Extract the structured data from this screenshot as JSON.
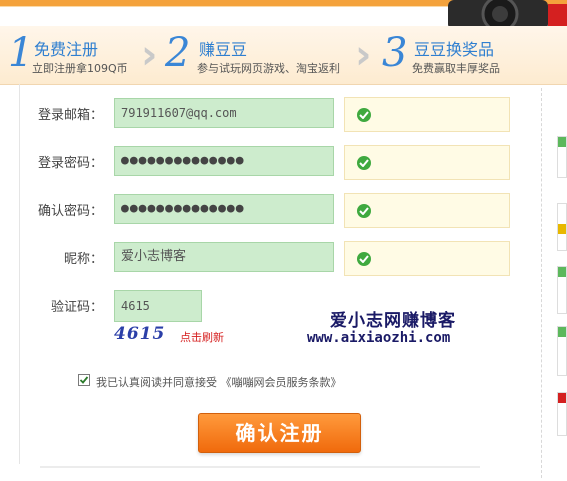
{
  "steps": [
    {
      "num": "1",
      "title": "免费注册",
      "sub": "立即注册拿109Q币"
    },
    {
      "num": "2",
      "title": "赚豆豆",
      "sub": "参与试玩网页游戏、淘宝返利"
    },
    {
      "num": "3",
      "title": "豆豆换奖品",
      "sub": "免费赢取丰厚奖品"
    }
  ],
  "form": {
    "email_label": "登录邮箱：",
    "email_value": "791911607@qq.com",
    "password_label": "登录密码：",
    "password_value": "●●●●●●●●●●●●●●",
    "confirm_label": "确认密码：",
    "confirm_value": "●●●●●●●●●●●●●●",
    "nick_label": "昵称：",
    "nick_value": "爱小志博客",
    "captcha_label": "验证码：",
    "captcha_value": "4615",
    "captcha_image_text": "4615",
    "refresh_label": "点击刷新"
  },
  "watermark": {
    "line1": "爱小志网赚博客",
    "line2": "www.aixiaozhi.com"
  },
  "agreement": {
    "checked": true,
    "text": "我已认真阅读并同意接受 《嘣嘣网会员服务条款》"
  },
  "submit_label": "确认注册",
  "colors": {
    "accent": "#3a86d6",
    "button": "#f06a0c",
    "field_ok": "#cdeccd",
    "check": "#3fa93f"
  }
}
